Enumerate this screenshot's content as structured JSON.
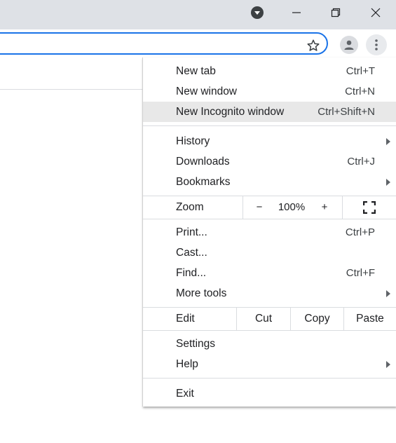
{
  "titlebar": {
    "icons": [
      "tab-search-icon",
      "minimize-icon",
      "restore-icon",
      "close-icon"
    ]
  },
  "toolbar": {
    "icons": [
      "star-icon",
      "profile-icon",
      "menu-icon"
    ]
  },
  "menu": {
    "items": [
      {
        "label": "New tab",
        "shortcut": "Ctrl+T"
      },
      {
        "label": "New window",
        "shortcut": "Ctrl+N"
      },
      {
        "label": "New Incognito window",
        "shortcut": "Ctrl+Shift+N"
      },
      {
        "label": "History",
        "shortcut": ""
      },
      {
        "label": "Downloads",
        "shortcut": "Ctrl+J"
      },
      {
        "label": "Bookmarks",
        "shortcut": ""
      },
      {
        "label": "Print...",
        "shortcut": "Ctrl+P"
      },
      {
        "label": "Cast...",
        "shortcut": ""
      },
      {
        "label": "Find...",
        "shortcut": "Ctrl+F"
      },
      {
        "label": "More tools",
        "shortcut": ""
      },
      {
        "label": "Settings",
        "shortcut": ""
      },
      {
        "label": "Help",
        "shortcut": ""
      },
      {
        "label": "Exit",
        "shortcut": ""
      }
    ],
    "zoom": {
      "label": "Zoom",
      "minus": "−",
      "value": "100%",
      "plus": "+"
    },
    "edit": {
      "label": "Edit",
      "cut": "Cut",
      "copy": "Copy",
      "paste": "Paste"
    }
  }
}
